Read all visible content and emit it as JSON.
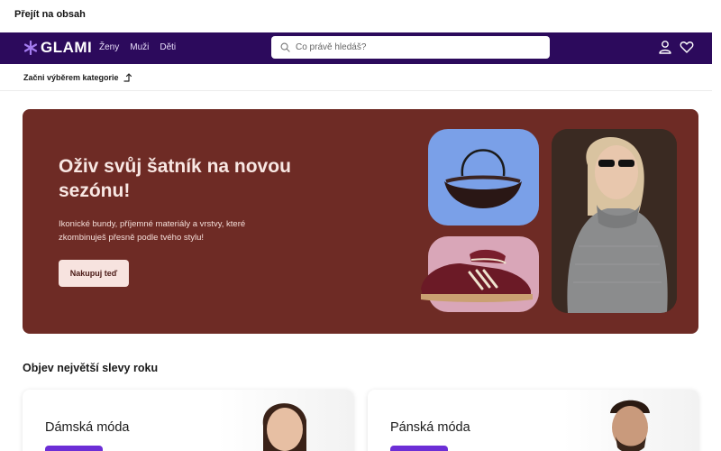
{
  "skip_link": "Přejít na obsah",
  "header": {
    "logo_text": "GLAMI",
    "nav": [
      "Ženy",
      "Muži",
      "Děti"
    ],
    "search_placeholder": "Co právě hledáš?",
    "colors": {
      "topbar": "#2c0a5c",
      "accent": "#a47cf0"
    }
  },
  "category_bar": {
    "label": "Začni výběrem kategorie"
  },
  "hero": {
    "title": "Oživ svůj šatník na novou sezónu!",
    "subtitle": "Ikonické bundy, příjemné materiály a vrstvy, které zkombinuješ přesně podle tvého stylu!",
    "button_label": "Nakupuj teď",
    "colors": {
      "background": "#6e2b25",
      "bag_tile": "#7aa0e8",
      "shoe_tile": "#d9a6b8"
    }
  },
  "deals": {
    "title": "Objev největší slevy roku",
    "cards": [
      {
        "title": "Dámská móda"
      },
      {
        "title": "Pánská móda"
      }
    ],
    "button_color": "#6c2ed6"
  }
}
